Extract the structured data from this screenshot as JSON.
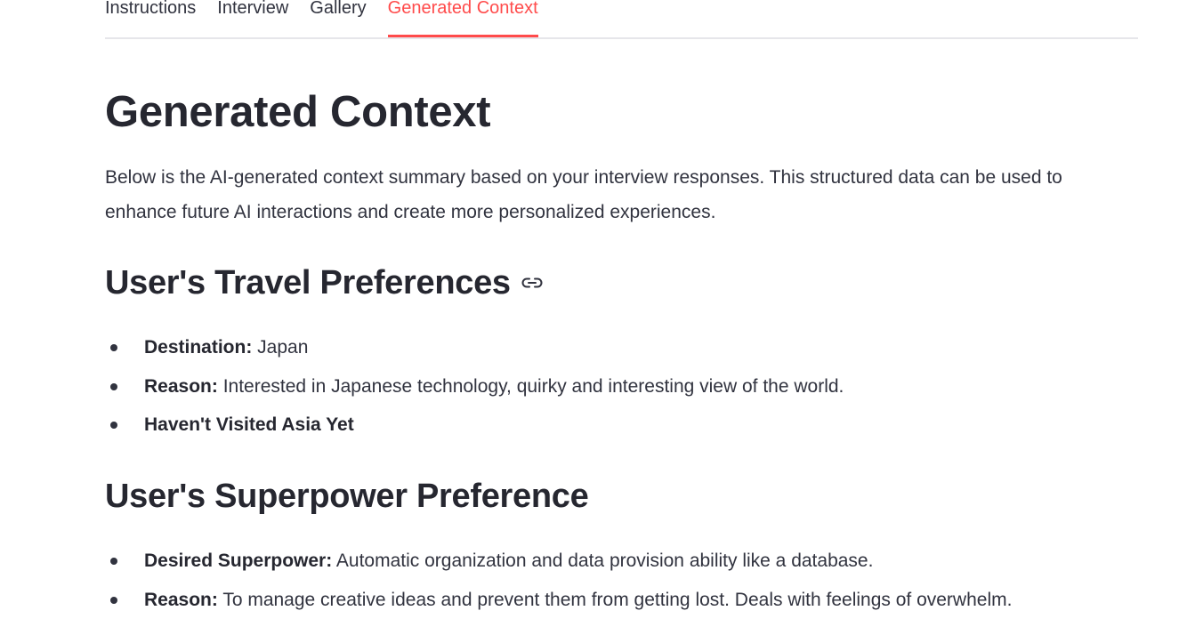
{
  "tabs": [
    {
      "label": "Instructions",
      "active": false
    },
    {
      "label": "Interview",
      "active": false
    },
    {
      "label": "Gallery",
      "active": false
    },
    {
      "label": "Generated Context",
      "active": true
    }
  ],
  "colors": {
    "accent": "#ff4b4b",
    "text": "#31333f",
    "heading": "#262730",
    "divider": "#e6e6ea"
  },
  "page": {
    "title": "Generated Context",
    "intro": "Below is the AI-generated context summary based on your interview responses. This structured data can be used to enhance future AI interactions and create more personalized experiences."
  },
  "sections": [
    {
      "heading": "User's Travel Preferences",
      "anchor_icon": "link-icon",
      "items": [
        {
          "label": "Destination:",
          "text": " Japan"
        },
        {
          "label": "Reason:",
          "text": " Interested in Japanese technology, quirky and interesting view of the world."
        },
        {
          "label": "Haven't Visited Asia Yet",
          "text": ""
        }
      ]
    },
    {
      "heading": "User's Superpower Preference",
      "items": [
        {
          "label": "Desired Superpower:",
          "text": " Automatic organization and data provision ability like a database."
        },
        {
          "label": "Reason:",
          "text": " To manage creative ideas and prevent them from getting lost. Deals with feelings of overwhelm."
        }
      ]
    }
  ]
}
